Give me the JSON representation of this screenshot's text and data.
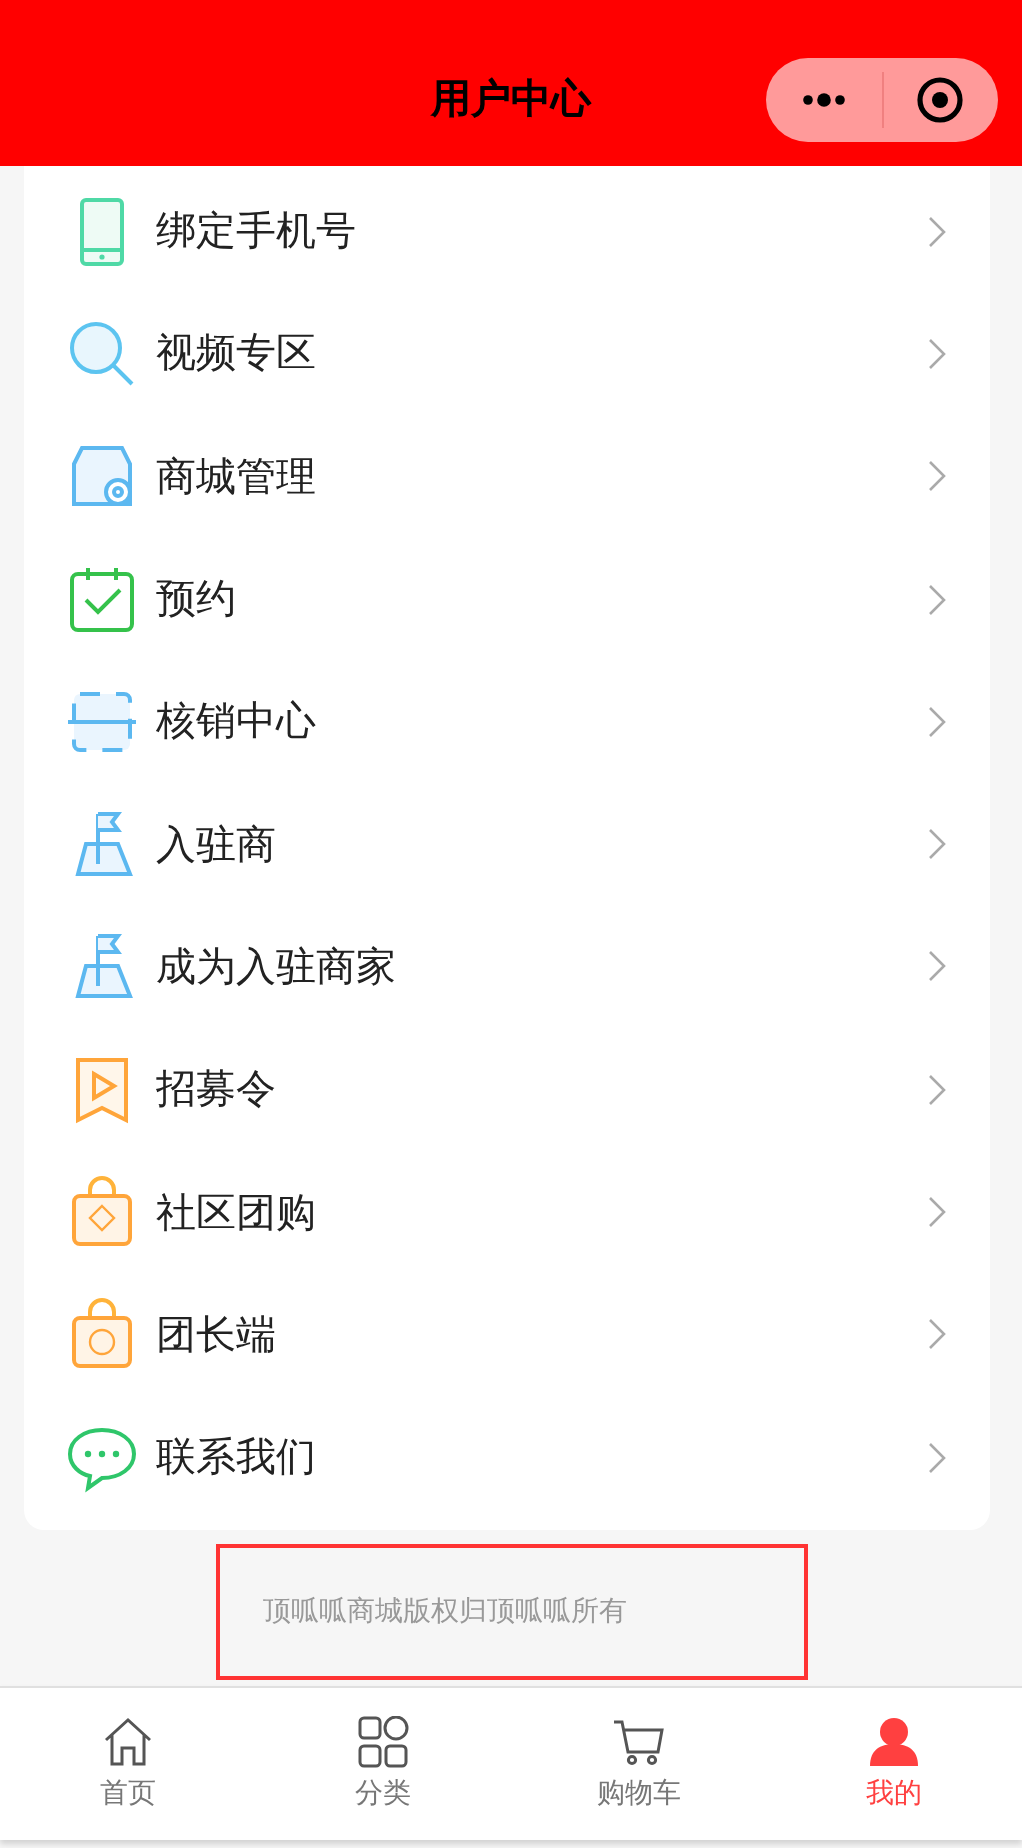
{
  "header": {
    "title": "用户中心"
  },
  "menu": [
    {
      "label": "绑定手机号"
    },
    {
      "label": "视频专区"
    },
    {
      "label": "商城管理"
    },
    {
      "label": "预约"
    },
    {
      "label": "核销中心"
    },
    {
      "label": "入驻商"
    },
    {
      "label": "成为入驻商家"
    },
    {
      "label": "招募令"
    },
    {
      "label": "社区团购"
    },
    {
      "label": "团长端"
    },
    {
      "label": "联系我们"
    }
  ],
  "footer": {
    "text": "顶呱呱商城版权归顶呱呱所有"
  },
  "tabbar": [
    {
      "label": "首页",
      "selected": false
    },
    {
      "label": "分类",
      "selected": false
    },
    {
      "label": "购物车",
      "selected": false
    },
    {
      "label": "我的",
      "selected": true
    }
  ]
}
